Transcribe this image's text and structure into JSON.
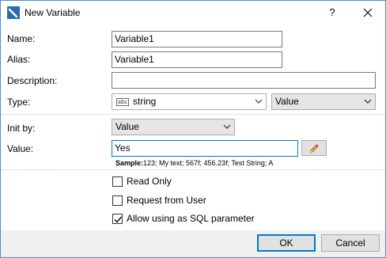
{
  "window": {
    "title": "New Variable",
    "help_label": "?"
  },
  "fields": {
    "name_label": "Name:",
    "name_value": "Variable1",
    "alias_label": "Alias:",
    "alias_value": "Variable1",
    "description_label": "Description:",
    "description_value": "",
    "type_label": "Type:",
    "type_value": "string",
    "type_mode_value": "Value",
    "init_by_label": "Init by:",
    "init_by_value": "Value",
    "value_label": "Value:",
    "value_value": "Yes",
    "sample_label": "Sample:",
    "sample_value": "123; My text; 567f; 456.23f; Test String; A"
  },
  "options": [
    {
      "label": "Read Only",
      "checked": false
    },
    {
      "label": "Request from User",
      "checked": false
    },
    {
      "label": "Allow using as SQL parameter",
      "checked": true
    }
  ],
  "buttons": {
    "ok_label": "OK",
    "cancel_label": "Cancel"
  },
  "icons": {
    "app": "variable-icon",
    "type": "abc-string-icon",
    "edit": "pencil-icon"
  },
  "colors": {
    "accent": "#0078d7",
    "border": "#4a8fd6"
  }
}
